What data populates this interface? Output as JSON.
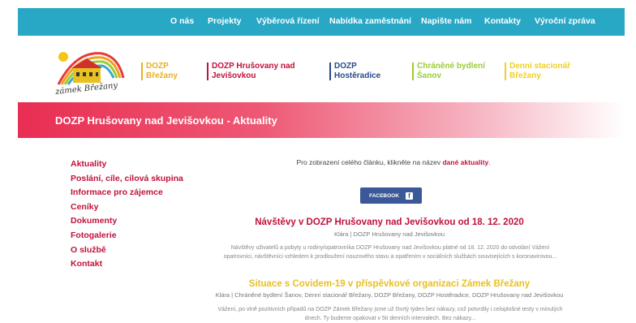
{
  "nav": {
    "items": [
      "O nás",
      "Projekty",
      "Výběrová řízení",
      "Nabídka zaměstnání",
      "Napište nám",
      "Kontakty",
      "Výroční zpráva"
    ]
  },
  "logo": {
    "text": "zámek Břežany"
  },
  "brands": [
    {
      "line1": "DOZP",
      "line2": "Břežany",
      "color": "#e8b020"
    },
    {
      "line1": "DOZP Hrušovany nad",
      "line2": "Jevišovkou",
      "color": "#c0123a"
    },
    {
      "line1": "DOZP",
      "line2": "Hostěradice",
      "color": "#2a4a8a"
    },
    {
      "line1": "Chráněné bydlení",
      "line2": "Šanov",
      "color": "#9acd32"
    },
    {
      "line1": "Denní stacionář",
      "line2": "Břežany",
      "color": "#f0d020"
    }
  ],
  "banner": {
    "title": "DOZP Hrušovany nad Jevišovkou - Aktuality"
  },
  "sidebar": {
    "items": [
      "Aktuality",
      "Poslání, cíle, cílová skupina",
      "Informace pro zájemce",
      "Ceníky",
      "Dokumenty",
      "Fotogalerie",
      "O službě",
      "Kontakt"
    ]
  },
  "intro": {
    "text": "Pro zobrazení celého článku, klikněte na název ",
    "link": "dané aktuality",
    "end": "."
  },
  "facebook": {
    "label": "FACEBOOK",
    "icon": "f"
  },
  "articles": [
    {
      "title": "Návštěvy v DOZP Hrušovany nad Jevišovkou od 18. 12. 2020",
      "color": "#c0123a",
      "meta": "Klára | DOZP Hrušovany nad Jevišovkou",
      "text1": "Návštěvy uživatelů a pobyty u rodiny/opatrovníka DOZP Hrušovany nad Jevišovkou platné od 18. 12. 2020 do odvolání Vážení",
      "text2": "opatrovníci, návštěvníci vzhledem k prodloužení nouzového stavu a opatřením v sociálních službách souvisejících s koronavirovou..."
    },
    {
      "title": "Situace s Covidem-19 v příspěvkové organizaci Zámek Břežany",
      "color": "#e8c020",
      "meta": "Klára | Chráněné bydlení Šanov, Denní stacionář Břežany, DOZP Břežany, DOZP Hostěradice, DOZP Hrušovany nad Jevišovkou",
      "text1": "Vážení, po vlně pozitivních případů na DOZP Zámek Břežany jsme už čtvrtý týden bez nákazy, což potvrdily i celoplošné testy v minulých",
      "text2": "dnech. Ty budeme opakovat v 5ti denních intervalech. Bez nákazy..."
    }
  ]
}
